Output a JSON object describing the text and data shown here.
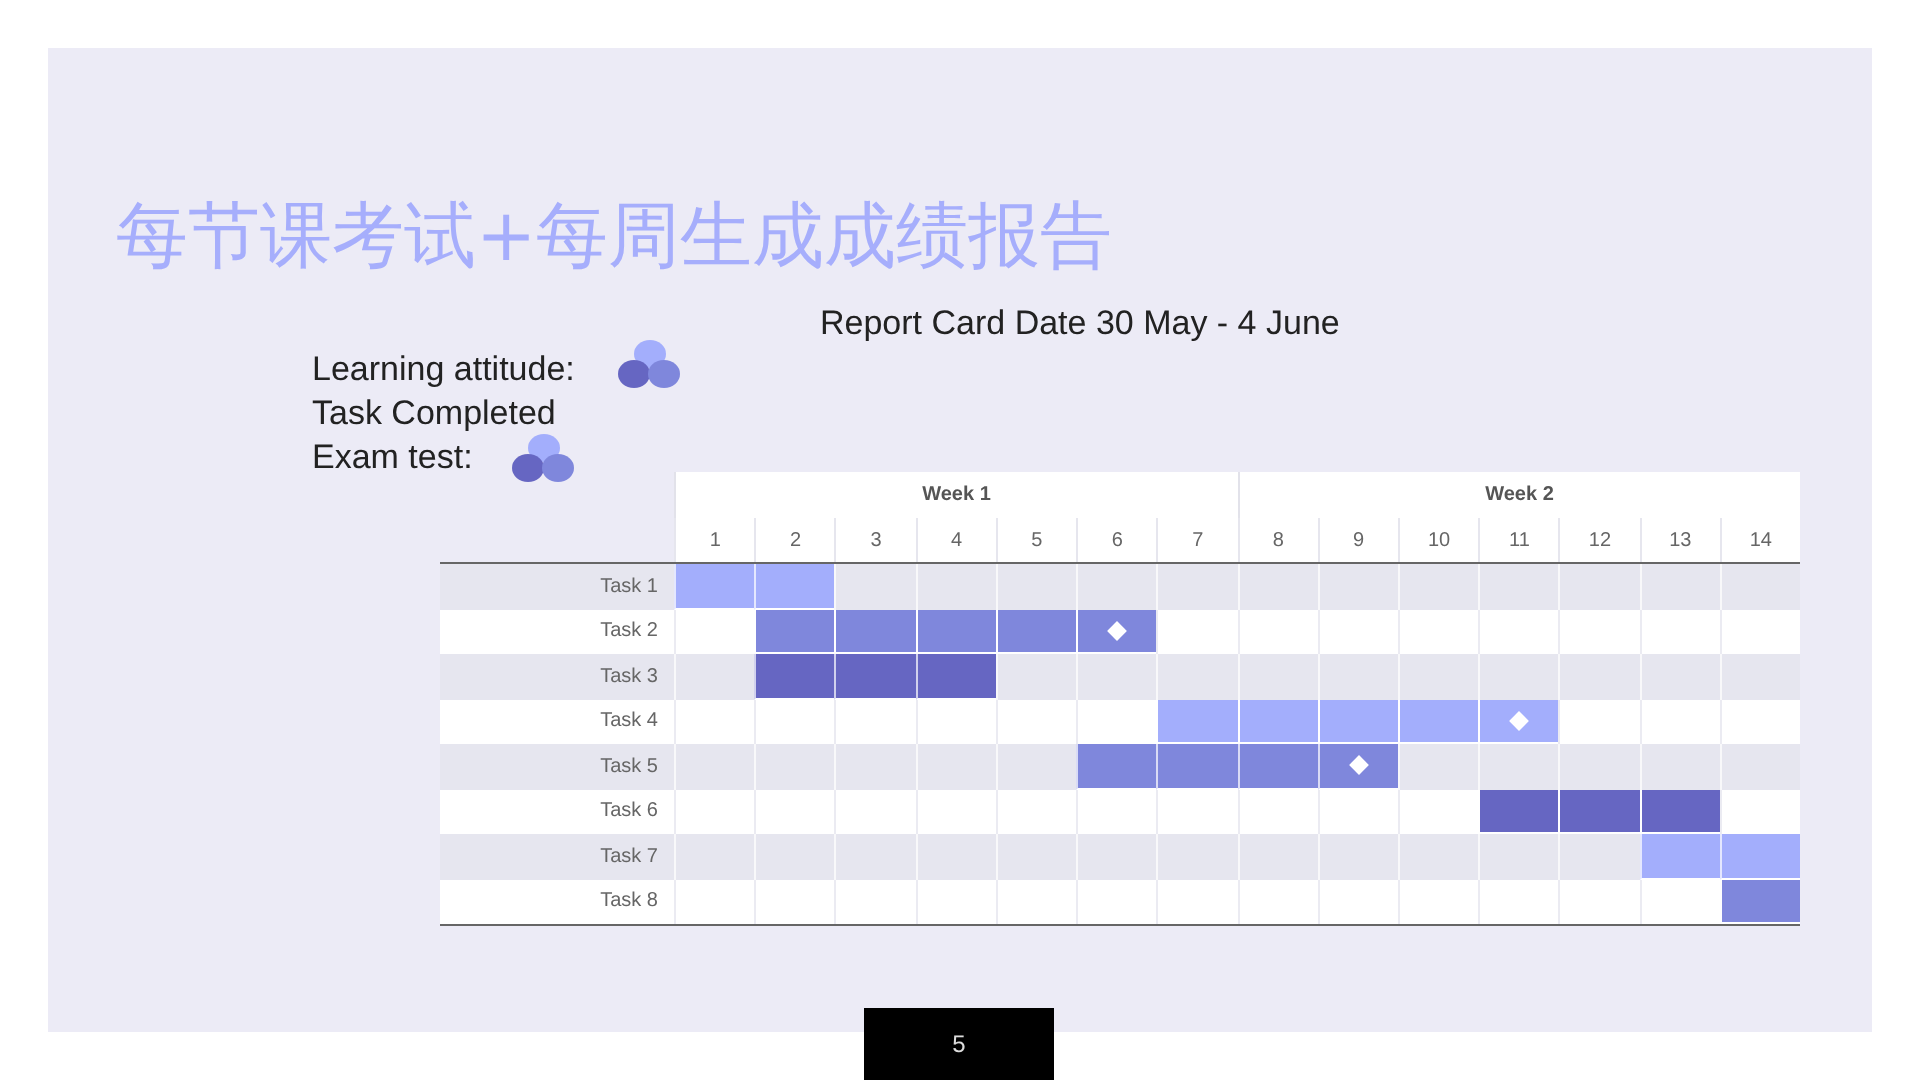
{
  "title": "每节课考试+每周生成成绩报告",
  "report_date": "Report Card Date 30 May - 4 June",
  "legend": [
    {
      "label": "Learning attitude:",
      "icon": true
    },
    {
      "label": "Task Completed",
      "icon": false
    },
    {
      "label": "Exam test:",
      "icon": true
    }
  ],
  "gantt": {
    "weeks": [
      "Week 1",
      "Week 2"
    ],
    "days": [
      "1",
      "2",
      "3",
      "4",
      "5",
      "6",
      "7",
      "8",
      "9",
      "10",
      "11",
      "12",
      "13",
      "14"
    ],
    "tasks": [
      {
        "name": "Task 1",
        "color": "#a3aefc",
        "cells": [
          {
            "filled": true,
            "milestone": false
          },
          {
            "filled": true,
            "milestone": false
          },
          {
            "filled": false,
            "milestone": false
          },
          {
            "filled": false,
            "milestone": false
          },
          {
            "filled": false,
            "milestone": false
          },
          {
            "filled": false,
            "milestone": false
          },
          {
            "filled": false,
            "milestone": false
          },
          {
            "filled": false,
            "milestone": false
          },
          {
            "filled": false,
            "milestone": false
          },
          {
            "filled": false,
            "milestone": false
          },
          {
            "filled": false,
            "milestone": false
          },
          {
            "filled": false,
            "milestone": false
          },
          {
            "filled": false,
            "milestone": false
          },
          {
            "filled": false,
            "milestone": false
          }
        ]
      },
      {
        "name": "Task 2",
        "color": "#7f87dc",
        "cells": [
          {
            "filled": false,
            "milestone": false
          },
          {
            "filled": true,
            "milestone": false
          },
          {
            "filled": true,
            "milestone": false
          },
          {
            "filled": true,
            "milestone": false
          },
          {
            "filled": true,
            "milestone": false
          },
          {
            "filled": true,
            "milestone": true
          },
          {
            "filled": false,
            "milestone": false
          },
          {
            "filled": false,
            "milestone": false
          },
          {
            "filled": false,
            "milestone": false
          },
          {
            "filled": false,
            "milestone": false
          },
          {
            "filled": false,
            "milestone": false
          },
          {
            "filled": false,
            "milestone": false
          },
          {
            "filled": false,
            "milestone": false
          },
          {
            "filled": false,
            "milestone": false
          }
        ]
      },
      {
        "name": "Task 3",
        "color": "#6666c2",
        "cells": [
          {
            "filled": false,
            "milestone": false
          },
          {
            "filled": true,
            "milestone": false
          },
          {
            "filled": true,
            "milestone": false
          },
          {
            "filled": true,
            "milestone": false
          },
          {
            "filled": false,
            "milestone": false
          },
          {
            "filled": false,
            "milestone": false
          },
          {
            "filled": false,
            "milestone": false
          },
          {
            "filled": false,
            "milestone": false
          },
          {
            "filled": false,
            "milestone": false
          },
          {
            "filled": false,
            "milestone": false
          },
          {
            "filled": false,
            "milestone": false
          },
          {
            "filled": false,
            "milestone": false
          },
          {
            "filled": false,
            "milestone": false
          },
          {
            "filled": false,
            "milestone": false
          }
        ]
      },
      {
        "name": "Task 4",
        "color": "#a3aefc",
        "cells": [
          {
            "filled": false,
            "milestone": false
          },
          {
            "filled": false,
            "milestone": false
          },
          {
            "filled": false,
            "milestone": false
          },
          {
            "filled": false,
            "milestone": false
          },
          {
            "filled": false,
            "milestone": false
          },
          {
            "filled": false,
            "milestone": false
          },
          {
            "filled": true,
            "milestone": false
          },
          {
            "filled": true,
            "milestone": false
          },
          {
            "filled": true,
            "milestone": false
          },
          {
            "filled": true,
            "milestone": false
          },
          {
            "filled": true,
            "milestone": true
          },
          {
            "filled": false,
            "milestone": false
          },
          {
            "filled": false,
            "milestone": false
          },
          {
            "filled": false,
            "milestone": false
          }
        ]
      },
      {
        "name": "Task 5",
        "color": "#7f87dc",
        "cells": [
          {
            "filled": false,
            "milestone": false
          },
          {
            "filled": false,
            "milestone": false
          },
          {
            "filled": false,
            "milestone": false
          },
          {
            "filled": false,
            "milestone": false
          },
          {
            "filled": false,
            "milestone": false
          },
          {
            "filled": true,
            "milestone": false
          },
          {
            "filled": true,
            "milestone": false
          },
          {
            "filled": true,
            "milestone": false
          },
          {
            "filled": true,
            "milestone": true
          },
          {
            "filled": false,
            "milestone": false
          },
          {
            "filled": false,
            "milestone": false
          },
          {
            "filled": false,
            "milestone": false
          },
          {
            "filled": false,
            "milestone": false
          },
          {
            "filled": false,
            "milestone": false
          }
        ]
      },
      {
        "name": "Task 6",
        "color": "#6666c2",
        "cells": [
          {
            "filled": false,
            "milestone": false
          },
          {
            "filled": false,
            "milestone": false
          },
          {
            "filled": false,
            "milestone": false
          },
          {
            "filled": false,
            "milestone": false
          },
          {
            "filled": false,
            "milestone": false
          },
          {
            "filled": false,
            "milestone": false
          },
          {
            "filled": false,
            "milestone": false
          },
          {
            "filled": false,
            "milestone": false
          },
          {
            "filled": false,
            "milestone": false
          },
          {
            "filled": false,
            "milestone": false
          },
          {
            "filled": true,
            "milestone": false
          },
          {
            "filled": true,
            "milestone": false
          },
          {
            "filled": true,
            "milestone": false
          },
          {
            "filled": false,
            "milestone": false
          }
        ]
      },
      {
        "name": "Task 7",
        "color": "#a3aefc",
        "cells": [
          {
            "filled": false,
            "milestone": false
          },
          {
            "filled": false,
            "milestone": false
          },
          {
            "filled": false,
            "milestone": false
          },
          {
            "filled": false,
            "milestone": false
          },
          {
            "filled": false,
            "milestone": false
          },
          {
            "filled": false,
            "milestone": false
          },
          {
            "filled": false,
            "milestone": false
          },
          {
            "filled": false,
            "milestone": false
          },
          {
            "filled": false,
            "milestone": false
          },
          {
            "filled": false,
            "milestone": false
          },
          {
            "filled": false,
            "milestone": false
          },
          {
            "filled": false,
            "milestone": false
          },
          {
            "filled": true,
            "milestone": false
          },
          {
            "filled": true,
            "milestone": false
          }
        ]
      },
      {
        "name": "Task 8",
        "color": "#7f87dc",
        "cells": [
          {
            "filled": false,
            "milestone": false
          },
          {
            "filled": false,
            "milestone": false
          },
          {
            "filled": false,
            "milestone": false
          },
          {
            "filled": false,
            "milestone": false
          },
          {
            "filled": false,
            "milestone": false
          },
          {
            "filled": false,
            "milestone": false
          },
          {
            "filled": false,
            "milestone": false
          },
          {
            "filled": false,
            "milestone": false
          },
          {
            "filled": false,
            "milestone": false
          },
          {
            "filled": false,
            "milestone": false
          },
          {
            "filled": false,
            "milestone": false
          },
          {
            "filled": false,
            "milestone": false
          },
          {
            "filled": false,
            "milestone": false
          },
          {
            "filled": true,
            "milestone": false
          }
        ]
      }
    ]
  },
  "page_number": "5"
}
